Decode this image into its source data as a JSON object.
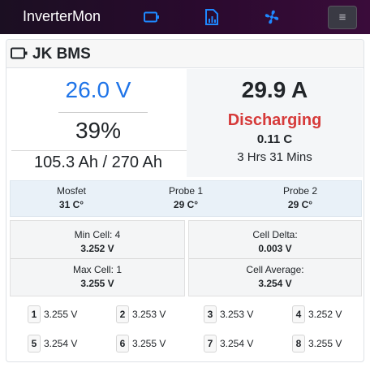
{
  "navbar": {
    "brand": "InverterMon",
    "icons": [
      "battery-icon",
      "chart-icon",
      "fan-icon"
    ],
    "menu_glyph": "≡"
  },
  "card": {
    "title": "JK BMS",
    "voltage": "26.0 V",
    "soc": "39%",
    "capacity": "105.3 Ah / 270 Ah",
    "current": "29.9 A",
    "status": "Discharging",
    "power": "0.11 C",
    "runtime": "3 Hrs 31 Mins"
  },
  "temps": [
    {
      "label": "Mosfet",
      "value": "31 C°"
    },
    {
      "label": "Probe 1",
      "value": "29 C°"
    },
    {
      "label": "Probe 2",
      "value": "29 C°"
    }
  ],
  "stats": {
    "min_cell_label": "Min Cell: 4",
    "min_cell_value": "3.252 V",
    "max_cell_label": "Max Cell: 1",
    "max_cell_value": "3.255 V",
    "delta_label": "Cell Delta:",
    "delta_value": "0.003 V",
    "avg_label": "Cell Average:",
    "avg_value": "3.254 V"
  },
  "cells": [
    {
      "num": "1",
      "volt": "3.255 V"
    },
    {
      "num": "2",
      "volt": "3.253 V"
    },
    {
      "num": "3",
      "volt": "3.253 V"
    },
    {
      "num": "4",
      "volt": "3.252 V"
    },
    {
      "num": "5",
      "volt": "3.254 V"
    },
    {
      "num": "6",
      "volt": "3.255 V"
    },
    {
      "num": "7",
      "volt": "3.254 V"
    },
    {
      "num": "8",
      "volt": "3.255 V"
    }
  ],
  "colors": {
    "accent": "#1f74e8",
    "discharge": "#d63a3a",
    "nav_icon": "#1e88ff"
  }
}
